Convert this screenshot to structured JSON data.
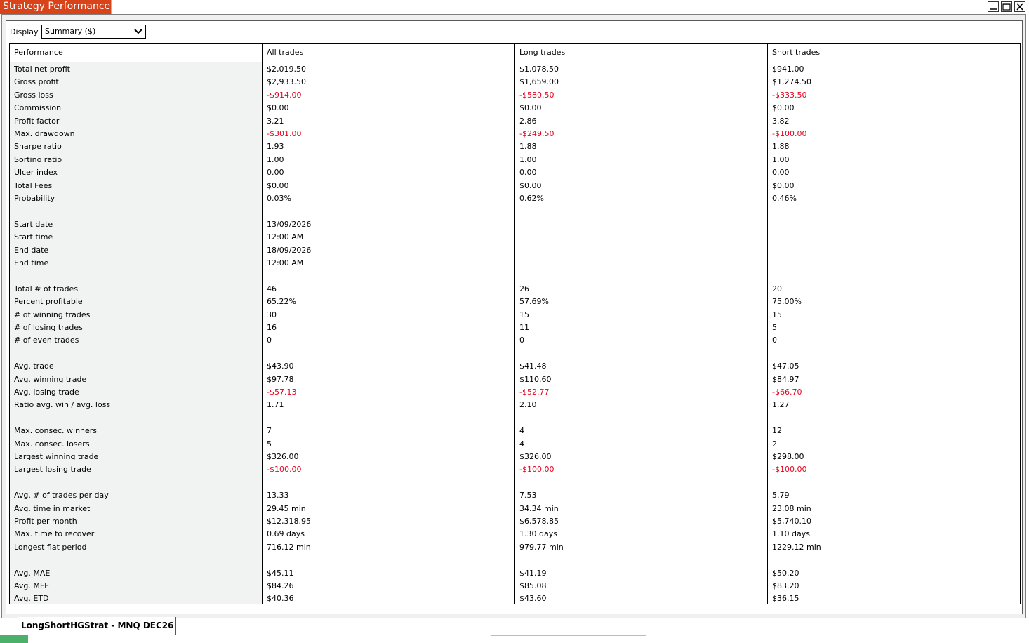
{
  "window": {
    "title": "Strategy Performance"
  },
  "display": {
    "label": "Display",
    "value": "Summary ($)"
  },
  "columns": [
    "Performance",
    "All trades",
    "Long trades",
    "Short trades"
  ],
  "rows": [
    {
      "label": "Total net profit",
      "values": [
        "$2,019.50",
        "$1,078.50",
        "$941.00"
      ],
      "neg": [
        false,
        false,
        false
      ],
      "slot": 0
    },
    {
      "label": "Gross profit",
      "values": [
        "$2,933.50",
        "$1,659.00",
        "$1,274.50"
      ],
      "neg": [
        false,
        false,
        false
      ],
      "slot": 1
    },
    {
      "label": "Gross loss",
      "values": [
        "-$914.00",
        "-$580.50",
        "-$333.50"
      ],
      "neg": [
        true,
        true,
        true
      ],
      "slot": 2
    },
    {
      "label": "Commission",
      "values": [
        "$0.00",
        "$0.00",
        "$0.00"
      ],
      "neg": [
        false,
        false,
        false
      ],
      "slot": 3
    },
    {
      "label": "Profit factor",
      "values": [
        "3.21",
        "2.86",
        "3.82"
      ],
      "neg": [
        false,
        false,
        false
      ],
      "slot": 4
    },
    {
      "label": "Max. drawdown",
      "values": [
        "-$301.00",
        "-$249.50",
        "-$100.00"
      ],
      "neg": [
        true,
        true,
        true
      ],
      "slot": 5
    },
    {
      "label": "Sharpe ratio",
      "values": [
        "1.93",
        "1.88",
        "1.88"
      ],
      "neg": [
        false,
        false,
        false
      ],
      "slot": 6
    },
    {
      "label": "Sortino ratio",
      "values": [
        "1.00",
        "1.00",
        "1.00"
      ],
      "neg": [
        false,
        false,
        false
      ],
      "slot": 7
    },
    {
      "label": "Ulcer index",
      "values": [
        "0.00",
        "0.00",
        "0.00"
      ],
      "neg": [
        false,
        false,
        false
      ],
      "slot": 8
    },
    {
      "label": "Total Fees",
      "values": [
        "$0.00",
        "$0.00",
        "$0.00"
      ],
      "neg": [
        false,
        false,
        false
      ],
      "slot": 9
    },
    {
      "label": "Probability",
      "values": [
        "0.03%",
        "0.62%",
        "0.46%"
      ],
      "neg": [
        false,
        false,
        false
      ],
      "slot": 10
    },
    {
      "label": "Start date",
      "values": [
        "13/09/2026",
        "",
        ""
      ],
      "neg": [
        false,
        false,
        false
      ],
      "slot": 12
    },
    {
      "label": "Start time",
      "values": [
        "12:00 AM",
        "",
        ""
      ],
      "neg": [
        false,
        false,
        false
      ],
      "slot": 13
    },
    {
      "label": "End date",
      "values": [
        "18/09/2026",
        "",
        ""
      ],
      "neg": [
        false,
        false,
        false
      ],
      "slot": 14
    },
    {
      "label": "End time",
      "values": [
        "12:00 AM",
        "",
        ""
      ],
      "neg": [
        false,
        false,
        false
      ],
      "slot": 15
    },
    {
      "label": "Total # of trades",
      "values": [
        "46",
        "26",
        "20"
      ],
      "neg": [
        false,
        false,
        false
      ],
      "slot": 17
    },
    {
      "label": "Percent profitable",
      "values": [
        "65.22%",
        "57.69%",
        "75.00%"
      ],
      "neg": [
        false,
        false,
        false
      ],
      "slot": 18
    },
    {
      "label": "# of winning trades",
      "values": [
        "30",
        "15",
        "15"
      ],
      "neg": [
        false,
        false,
        false
      ],
      "slot": 19
    },
    {
      "label": "# of losing trades",
      "values": [
        "16",
        "11",
        "5"
      ],
      "neg": [
        false,
        false,
        false
      ],
      "slot": 20
    },
    {
      "label": "# of even trades",
      "values": [
        "0",
        "0",
        "0"
      ],
      "neg": [
        false,
        false,
        false
      ],
      "slot": 21
    },
    {
      "label": "Avg. trade",
      "values": [
        "$43.90",
        "$41.48",
        "$47.05"
      ],
      "neg": [
        false,
        false,
        false
      ],
      "slot": 23
    },
    {
      "label": "Avg. winning trade",
      "values": [
        "$97.78",
        "$110.60",
        "$84.97"
      ],
      "neg": [
        false,
        false,
        false
      ],
      "slot": 24
    },
    {
      "label": "Avg. losing trade",
      "values": [
        "-$57.13",
        "-$52.77",
        "-$66.70"
      ],
      "neg": [
        true,
        true,
        true
      ],
      "slot": 25
    },
    {
      "label": "Ratio avg. win / avg. loss",
      "values": [
        "1.71",
        "2.10",
        "1.27"
      ],
      "neg": [
        false,
        false,
        false
      ],
      "slot": 26
    },
    {
      "label": "Max. consec. winners",
      "values": [
        "7",
        "4",
        "12"
      ],
      "neg": [
        false,
        false,
        false
      ],
      "slot": 28
    },
    {
      "label": "Max. consec. losers",
      "values": [
        "5",
        "4",
        "2"
      ],
      "neg": [
        false,
        false,
        false
      ],
      "slot": 29
    },
    {
      "label": "Largest winning trade",
      "values": [
        "$326.00",
        "$326.00",
        "$298.00"
      ],
      "neg": [
        false,
        false,
        false
      ],
      "slot": 30
    },
    {
      "label": "Largest losing trade",
      "values": [
        "-$100.00",
        "-$100.00",
        "-$100.00"
      ],
      "neg": [
        true,
        true,
        true
      ],
      "slot": 31
    },
    {
      "label": "Avg. # of trades per day",
      "values": [
        "13.33",
        "7.53",
        "5.79"
      ],
      "neg": [
        false,
        false,
        false
      ],
      "slot": 33
    },
    {
      "label": "Avg. time in market",
      "values": [
        "29.45 min",
        "34.34 min",
        "23.08 min"
      ],
      "neg": [
        false,
        false,
        false
      ],
      "slot": 34
    },
    {
      "label": "Profit per month",
      "values": [
        "$12,318.95",
        "$6,578.85",
        "$5,740.10"
      ],
      "neg": [
        false,
        false,
        false
      ],
      "slot": 35
    },
    {
      "label": "Max. time to recover",
      "values": [
        "0.69 days",
        "1.30 days",
        "1.10 days"
      ],
      "neg": [
        false,
        false,
        false
      ],
      "slot": 36
    },
    {
      "label": "Longest flat period",
      "values": [
        "716.12 min",
        "979.77 min",
        "1229.12 min"
      ],
      "neg": [
        false,
        false,
        false
      ],
      "slot": 37
    },
    {
      "label": "Avg. MAE",
      "values": [
        "$45.11",
        "$41.19",
        "$50.20"
      ],
      "neg": [
        false,
        false,
        false
      ],
      "slot": 39
    },
    {
      "label": "Avg. MFE",
      "values": [
        "$84.26",
        "$85.08",
        "$83.20"
      ],
      "neg": [
        false,
        false,
        false
      ],
      "slot": 40
    },
    {
      "label": "Avg. ETD",
      "values": [
        "$40.36",
        "$43.60",
        "$36.15"
      ],
      "neg": [
        false,
        false,
        false
      ],
      "slot": 41
    }
  ],
  "bottom_tab": {
    "label": "LongShortHGStrat - MNQ DEC26"
  },
  "colors": {
    "title_bg": "#d9431a",
    "negative": "#e8001c",
    "label_col_bg": "#f1f3f2"
  }
}
